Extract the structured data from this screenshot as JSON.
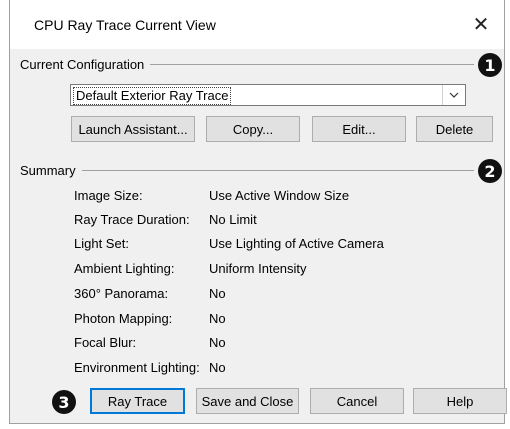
{
  "window": {
    "title": "CPU Ray Trace Current View"
  },
  "config": {
    "group_label": "Current Configuration",
    "selected": "Default Exterior Ray Trace",
    "buttons": {
      "launch": "Launch Assistant...",
      "copy": "Copy...",
      "edit": "Edit...",
      "delete": "Delete"
    }
  },
  "summary": {
    "group_label": "Summary",
    "rows": [
      {
        "label": "Image Size:",
        "value": "Use Active Window Size"
      },
      {
        "label": "Ray Trace Duration:",
        "value": "No Limit"
      },
      {
        "label": "Light Set:",
        "value": "Use Lighting of Active Camera"
      },
      {
        "label": "Ambient Lighting:",
        "value": "Uniform Intensity"
      },
      {
        "label": "360° Panorama:",
        "value": "No"
      },
      {
        "label": "Photon Mapping:",
        "value": "No"
      },
      {
        "label": "Focal Blur:",
        "value": "No"
      },
      {
        "label": "Environment Lighting:",
        "value": "No"
      }
    ]
  },
  "footer": {
    "ray_trace": "Ray Trace",
    "save_close": "Save and Close",
    "cancel": "Cancel",
    "help": "Help"
  },
  "callouts": [
    "1",
    "2",
    "3"
  ],
  "colors": {
    "dialog_bg": "#f0f0f0",
    "accent": "#0078d7",
    "callout": "#111111"
  }
}
